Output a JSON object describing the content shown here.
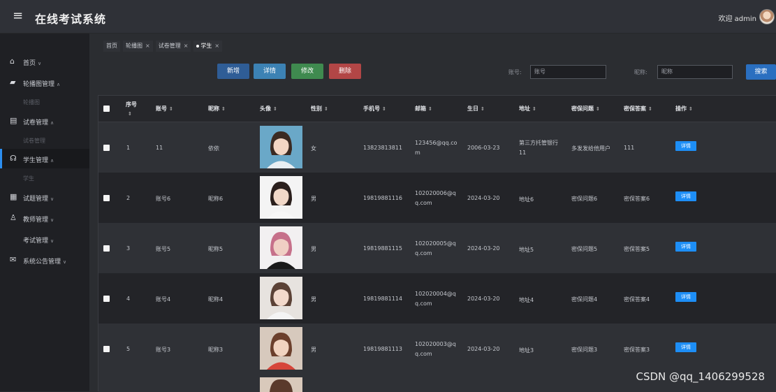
{
  "header": {
    "title": "在线考试系统",
    "welcome": "欢迎 admin"
  },
  "sidebar": {
    "items": [
      {
        "label": "首页",
        "icon": "home-icon",
        "arrow": "∨"
      },
      {
        "label": "轮播图管理",
        "icon": "briefcase-icon",
        "arrow": "∧"
      },
      {
        "sub": "轮播图"
      },
      {
        "label": "试卷管理",
        "icon": "list-icon",
        "arrow": "∧"
      },
      {
        "sub": "试卷管理"
      },
      {
        "label": "学生管理",
        "icon": "student-icon",
        "arrow": "∧"
      },
      {
        "sub": "学生"
      },
      {
        "label": "试题管理",
        "icon": "grid-icon",
        "arrow": "∨"
      },
      {
        "label": "教师管理",
        "icon": "person-icon",
        "arrow": "∨"
      },
      {
        "label": "考试管理",
        "icon": "",
        "arrow": "∨"
      },
      {
        "label": "系统公告管理",
        "icon": "mail-icon",
        "arrow": "∨"
      }
    ]
  },
  "tabs": [
    {
      "label": "首页",
      "closable": false
    },
    {
      "label": "轮播图",
      "closable": true
    },
    {
      "label": "试卷管理",
      "closable": true
    },
    {
      "label": "学生",
      "closable": true,
      "current": true
    }
  ],
  "toolbar": {
    "add": "新增",
    "detail": "详情",
    "edit": "修改",
    "delete": "删除"
  },
  "search": {
    "account_label": "账号:",
    "account_placeholder": "账号",
    "nickname_label": "昵称:",
    "nickname_placeholder": "昵称",
    "button": "搜索"
  },
  "table": {
    "columns": [
      "序号",
      "账号",
      "昵称",
      "头像",
      "性别",
      "手机号",
      "邮箱",
      "生日",
      "地址",
      "密保问题",
      "密保答案",
      "操作"
    ],
    "sort_glyph": "⇕",
    "rows": [
      {
        "no": "1",
        "account": "11",
        "nickname": "依依",
        "gender": "女",
        "phone": "13823813811",
        "email": [
          "123456@qq.co",
          "m"
        ],
        "birthday": "2006-03-23",
        "address": [
          "第三方托管银行",
          "11"
        ],
        "question": "多发发给他用户",
        "answer": "111",
        "action": "详情"
      },
      {
        "no": "2",
        "account": "账号6",
        "nickname": "昵称6",
        "gender": "男",
        "phone": "19819881116",
        "email": [
          "102020006@q",
          "q.com"
        ],
        "birthday": "2024-03-20",
        "address": [
          "地址6",
          ""
        ],
        "question": "密保问题6",
        "answer": "密保答案6",
        "action": "详情"
      },
      {
        "no": "3",
        "account": "账号5",
        "nickname": "昵称5",
        "gender": "男",
        "phone": "19819881115",
        "email": [
          "102020005@q",
          "q.com"
        ],
        "birthday": "2024-03-20",
        "address": [
          "地址5",
          ""
        ],
        "question": "密保问题5",
        "answer": "密保答案5",
        "action": "详情"
      },
      {
        "no": "4",
        "account": "账号4",
        "nickname": "昵称4",
        "gender": "男",
        "phone": "19819881114",
        "email": [
          "102020004@q",
          "q.com"
        ],
        "birthday": "2024-03-20",
        "address": [
          "地址4",
          ""
        ],
        "question": "密保问题4",
        "answer": "密保答案4",
        "action": "详情"
      },
      {
        "no": "5",
        "account": "账号3",
        "nickname": "昵称3",
        "gender": "男",
        "phone": "19819881113",
        "email": [
          "102020003@q",
          "q.com"
        ],
        "birthday": "2024-03-20",
        "address": [
          "地址3",
          ""
        ],
        "question": "密保问题3",
        "answer": "密保答案3",
        "action": "详情"
      }
    ]
  },
  "watermark": "CSDN @qq_1406299528",
  "colors": {
    "accent": "#1d8ef6",
    "add": "#2f5d96",
    "detail": "#3c82b4",
    "edit": "#3f8a4f",
    "delete": "#b24646"
  }
}
